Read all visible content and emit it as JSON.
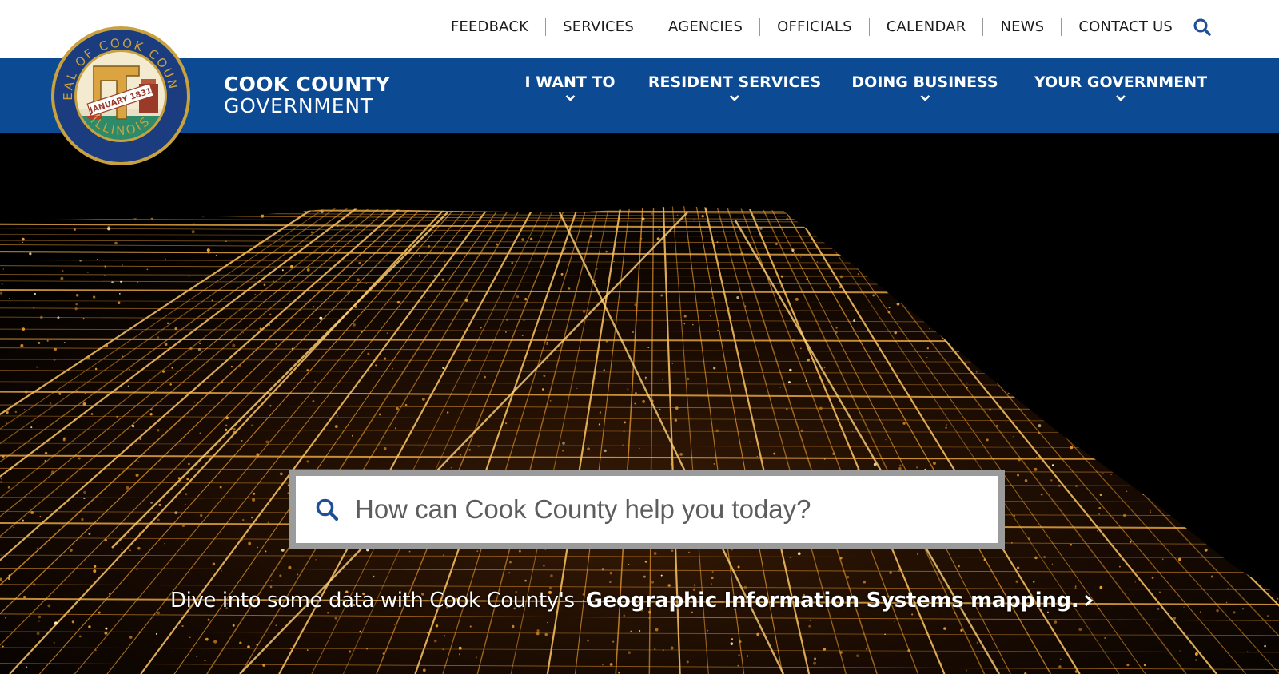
{
  "site": {
    "brand_line1": "COOK COUNTY",
    "brand_line2": "GOVERNMENT",
    "seal_text": "SEAL OF COOK COUNTY ILLINOIS",
    "seal_banner": "JANUARY 1831"
  },
  "utility_nav": {
    "items": [
      "FEEDBACK",
      "SERVICES",
      "AGENCIES",
      "OFFICIALS",
      "CALENDAR",
      "NEWS",
      "CONTACT US"
    ],
    "search_icon": "search-icon"
  },
  "main_nav": {
    "items": [
      {
        "label": "I WANT TO",
        "icon": "chevron-down-icon"
      },
      {
        "label": "RESIDENT SERVICES",
        "icon": "chevron-down-icon"
      },
      {
        "label": "DOING BUSINESS",
        "icon": "chevron-down-icon"
      },
      {
        "label": "YOUR GOVERNMENT",
        "icon": "chevron-down-icon"
      }
    ]
  },
  "hero": {
    "search_placeholder": "How can Cook County help you today?",
    "search_value": "",
    "gis_text": "Dive into some data with Cook County's",
    "gis_link": "Geographic Information Systems mapping.",
    "gis_icon": "chevron-right-icon"
  },
  "colors": {
    "brand_blue": "#0c4a93",
    "search_icon_blue": "#1f4e94",
    "city_lights": "#f0a030",
    "seal_gold": "#c9a23f"
  }
}
